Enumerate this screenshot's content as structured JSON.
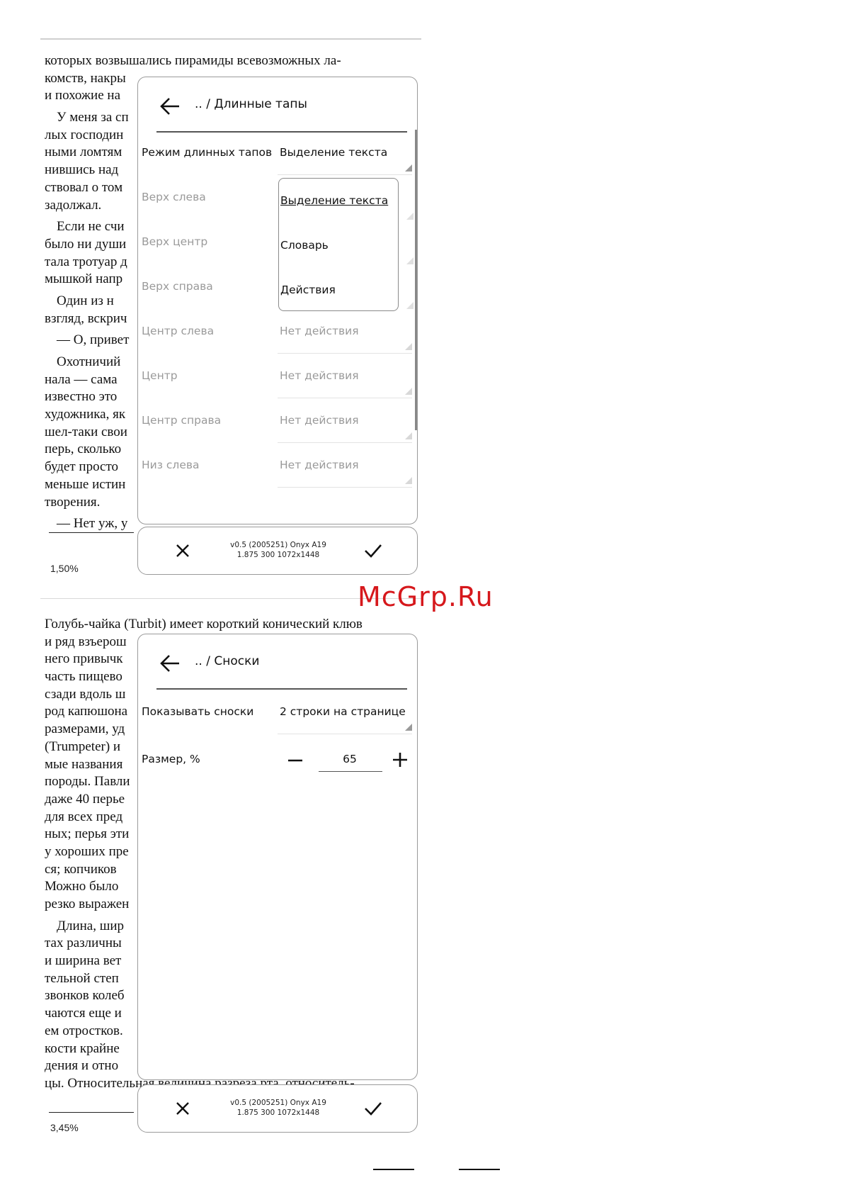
{
  "top": {
    "book_lines": [
      {
        "t": "которых возвышались пирамиды всевозможных ла-",
        "p": false,
        "i": false
      },
      {
        "t": "комств, накры",
        "p": false,
        "i": false
      },
      {
        "t": "и похожие на",
        "p": false,
        "i": false
      },
      {
        "t": "У меня за сп",
        "p": true,
        "i": true
      },
      {
        "t": "лых господин",
        "p": false,
        "i": false
      },
      {
        "t": "ными ломтям",
        "p": false,
        "i": false
      },
      {
        "t": "нившись над",
        "p": false,
        "i": false
      },
      {
        "t": "ствовал о том",
        "p": false,
        "i": false
      },
      {
        "t": "задолжал.",
        "p": false,
        "i": false
      },
      {
        "t": "Если не счи",
        "p": true,
        "i": true
      },
      {
        "t": "было ни души",
        "p": false,
        "i": false
      },
      {
        "t": "тала тротуар д",
        "p": false,
        "i": false
      },
      {
        "t": "мышкой напр",
        "p": false,
        "i": false
      },
      {
        "t": "Один из н",
        "p": true,
        "i": true
      },
      {
        "t": "взгляд, вскрич",
        "p": false,
        "i": false
      },
      {
        "t": "— О, привет",
        "p": true,
        "i": true
      },
      {
        "t": "Охотничий",
        "p": true,
        "i": true
      },
      {
        "t": "нала — сама",
        "p": false,
        "i": false
      },
      {
        "t": "известно это",
        "p": false,
        "i": false
      },
      {
        "t": "художника, як",
        "p": false,
        "i": false
      },
      {
        "t": "шел-таки свои",
        "p": false,
        "i": false
      },
      {
        "t": "перь, сколько",
        "p": false,
        "i": false
      },
      {
        "t": "будет просто",
        "p": false,
        "i": false
      },
      {
        "t": "меньше истин",
        "p": false,
        "i": false
      },
      {
        "t": "творения.",
        "p": false,
        "i": false
      },
      {
        "t": "— Нет уж, у",
        "p": true,
        "i": true
      }
    ],
    "progress": "1,50%",
    "dialog": {
      "title": ".. / Длинные тапы",
      "rows": [
        {
          "label": "Режим длинных тапов",
          "value": "Выделение текста",
          "dim": false
        },
        {
          "label": "Верх слева",
          "value": "",
          "dim": true
        },
        {
          "label": "Верх центр",
          "value": "",
          "dim": true
        },
        {
          "label": "Верх справа",
          "value": "",
          "dim": true
        },
        {
          "label": "Центр слева",
          "value": "Нет действия",
          "dim": true
        },
        {
          "label": "Центр",
          "value": "Нет действия",
          "dim": true
        },
        {
          "label": "Центр справа",
          "value": "Нет действия",
          "dim": true
        },
        {
          "label": "Низ слева",
          "value": "Нет действия",
          "dim": true
        }
      ],
      "dropdown_options": [
        "Выделение текста",
        "Словарь",
        "Действия"
      ],
      "dropdown_selected": "Выделение текста"
    },
    "footer": {
      "version_line1": "v0.5 (2005251) Onyx A19",
      "version_line2": "1.875 300 1072x1448"
    }
  },
  "bottom": {
    "book_lines": [
      {
        "t": "Голубь-чайка (Turbit) имеет короткий конический клюв",
        "p": false,
        "i": false
      },
      {
        "t": "и ряд взъерош",
        "p": false,
        "i": false
      },
      {
        "t": "него привычк",
        "p": false,
        "i": false
      },
      {
        "t": "часть пищево",
        "p": false,
        "i": false
      },
      {
        "t": "сзади вдоль ш",
        "p": false,
        "i": false
      },
      {
        "t": "род капюшона",
        "p": false,
        "i": false
      },
      {
        "t": "размерами, уд",
        "p": false,
        "i": false
      },
      {
        "t": "(Trumpeter) и",
        "p": false,
        "i": false
      },
      {
        "t": "мые названия",
        "p": false,
        "i": false
      },
      {
        "t": "породы. Павли",
        "p": false,
        "i": false
      },
      {
        "t": "даже 40 перье",
        "p": false,
        "i": false
      },
      {
        "t": "для всех пред",
        "p": false,
        "i": false
      },
      {
        "t": "ных; перья эти",
        "p": false,
        "i": false
      },
      {
        "t": "у хороших пре",
        "p": false,
        "i": false
      },
      {
        "t": "ся; копчиков",
        "p": false,
        "i": false
      },
      {
        "t": "Можно было",
        "p": false,
        "i": false
      },
      {
        "t": "резко выражен",
        "p": false,
        "i": false
      },
      {
        "t": "Длина, шир",
        "p": true,
        "i": true
      },
      {
        "t": "тах различны",
        "p": false,
        "i": false
      },
      {
        "t": "и ширина вет",
        "p": false,
        "i": false
      },
      {
        "t": "тельной степ",
        "p": false,
        "i": false
      },
      {
        "t": "звонков колеб",
        "p": false,
        "i": false
      },
      {
        "t": "чаются еще и",
        "p": false,
        "i": false
      },
      {
        "t": "ем отростков.",
        "p": false,
        "i": false
      },
      {
        "t": "кости крайне",
        "p": false,
        "i": false
      },
      {
        "t": "дения и отно",
        "p": false,
        "i": false
      },
      {
        "t": "цы. Относительная величина разреза рта, относитель-",
        "p": false,
        "i": false
      }
    ],
    "progress": "3,45%",
    "dialog": {
      "title": ".. / Сноски",
      "show_label": "Показывать сноски",
      "show_value": "2 строки на странице",
      "size_label": "Размер, %",
      "size_value": "65"
    },
    "footer": {
      "version_line1": "v0.5 (2005251) Onyx A19",
      "version_line2": "1.875 300 1072x1448"
    }
  },
  "watermark": "McGrp.Ru",
  "colors": {
    "watermark": "#d6181c",
    "dim_text": "#9a9a9a",
    "border": "#9a9a9a"
  }
}
